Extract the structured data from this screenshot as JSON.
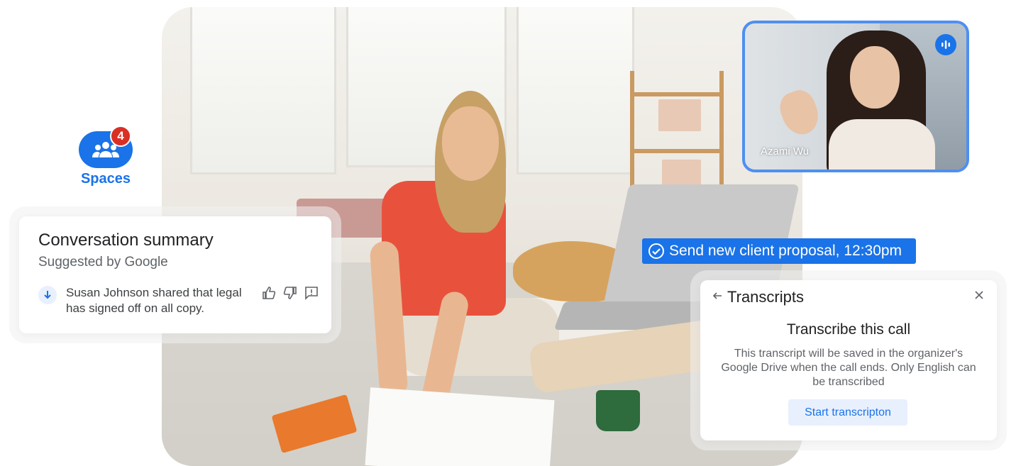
{
  "spaces": {
    "label": "Spaces",
    "badge": "4",
    "icon": "group-icon",
    "accent": "#1a73e8",
    "badge_color": "#d93025"
  },
  "summary": {
    "title": "Conversation summary",
    "subtitle": "Suggested by Google",
    "item": "Susan Johnson shared that legal has signed off on all copy.",
    "icons": [
      "arrow-down-icon",
      "thumbs-up-icon",
      "thumbs-down-icon",
      "feedback-icon"
    ]
  },
  "task": {
    "label": "Send new client proposal, 12:30pm",
    "icon": "check-circle-icon",
    "color": "#1a73e8"
  },
  "video": {
    "name": "Azami Wu",
    "indicator": "speaking-icon",
    "border_color": "#4f8ff0"
  },
  "transcripts": {
    "title": "Transcripts",
    "heading": "Transcribe this call",
    "body": "This transcript will be saved in the organizer's Google Drive when the call ends. Only English can be transcribed",
    "button": "Start transcripton",
    "icons": [
      "back-arrow-icon",
      "close-icon"
    ]
  }
}
